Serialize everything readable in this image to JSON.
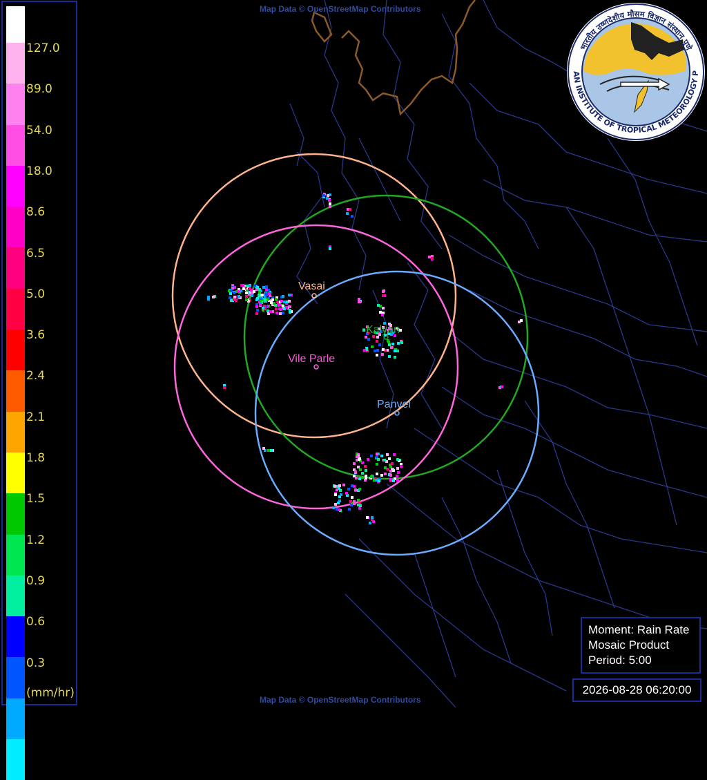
{
  "legend": {
    "unit": "(mm/hr)",
    "colors": [
      "#ffffff",
      "#ffb3ee",
      "#ff80f0",
      "#ff4de6",
      "#ff00ff",
      "#ff00c8",
      "#ff0080",
      "#ff0044",
      "#ff0000",
      "#ff5a00",
      "#ffa500",
      "#ffff00",
      "#00c800",
      "#00e650",
      "#00f0a0",
      "#0000ff",
      "#0055ff",
      "#00aaff",
      "#00eeff"
    ],
    "labels": [
      "127.0",
      "89.0",
      "54.0",
      "18.0",
      "8.6",
      "6.5",
      "5.0",
      "3.6",
      "2.4",
      "2.1",
      "1.8",
      "1.5",
      "1.2",
      "0.9",
      "0.6",
      "0.3"
    ]
  },
  "attribution_top": "Map Data © OpenStreetMap Contributors",
  "attribution_bottom": "Map Data © OpenStreetMap Contributors",
  "cities": {
    "vasai": {
      "name": "Vasai",
      "color": "#ffb48c"
    },
    "kalyan": {
      "name": "Kalyan",
      "color": "#22b822"
    },
    "vile_parle": {
      "name": "Vile Parle",
      "color": "#ff55dd"
    },
    "panvel": {
      "name": "Panvel",
      "color": "#6aacff"
    }
  },
  "info": {
    "moment": "Moment: Rain Rate",
    "product": "Mosaic Product",
    "period": "Period: 5:00"
  },
  "timestamp": "2026-08-28 06:20:00",
  "logo": {
    "text_top": "भारतीय उष्णदेशीय मौसम विज्ञान संस्थान पुणे",
    "text_bottom": "INDIAN INSTITUTE OF TROPICAL METEOROLOGY PUNE"
  }
}
